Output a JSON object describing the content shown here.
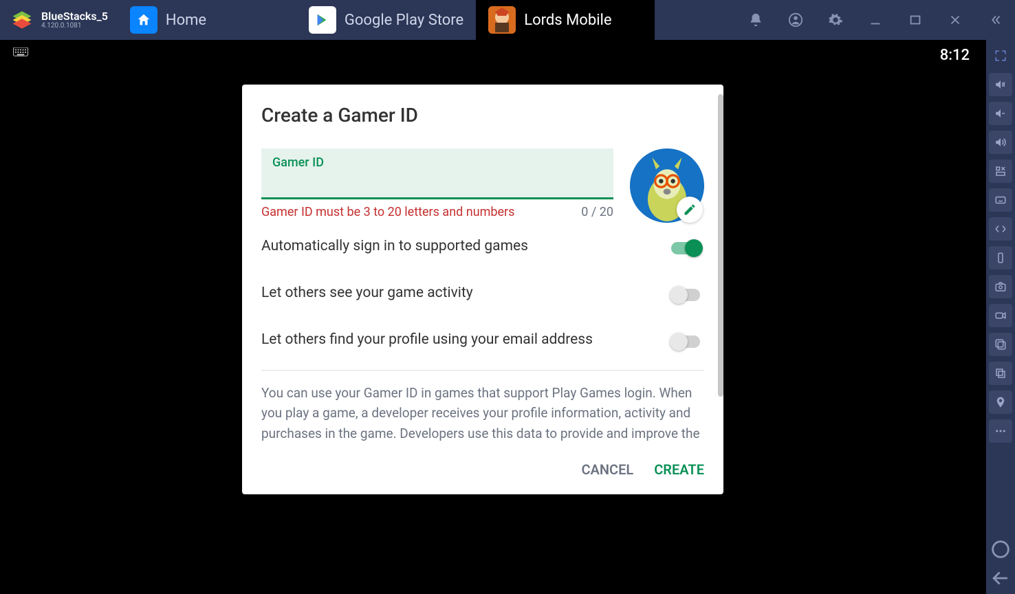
{
  "brand": {
    "title": "BlueStacks_5",
    "version": "4.120.0.1081"
  },
  "tabs": [
    {
      "label": "Home",
      "active": false
    },
    {
      "label": "Google Play Store",
      "active": false
    },
    {
      "label": "Lords Mobile",
      "active": true
    }
  ],
  "status": {
    "time": "8:12"
  },
  "modal": {
    "title": "Create a Gamer ID",
    "input_label": "Gamer ID",
    "input_value": "",
    "error": "Gamer ID must be 3 to 20 letters and numbers",
    "counter": "0 / 20",
    "toggles": [
      {
        "label": "Automatically sign in to supported games",
        "on": true
      },
      {
        "label": "Let others see your game activity",
        "on": false
      },
      {
        "label": "Let others find your profile using your email address",
        "on": false
      }
    ],
    "disclosure": "You can use your Gamer ID in games that support Play Games login. When you play a game, a developer receives your profile information, activity and purchases in the game. Developers use this data to provide and improve the",
    "cancel_label": "CANCEL",
    "create_label": "CREATE"
  }
}
